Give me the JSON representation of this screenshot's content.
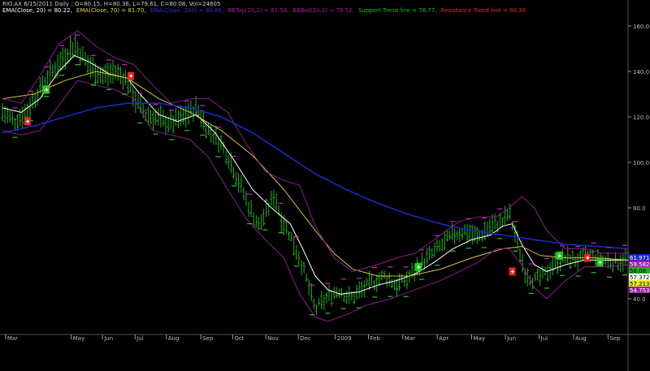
{
  "header": {
    "line1": "RIO.AX 6/15/2011 Daily : O=80.15, H=80.36, L=79.61, C=80.08, Vol=24605",
    "items": [
      {
        "text": "EMA(Close, 20) = 80.22,",
        "color": "#ffffff"
      },
      {
        "text": "EMA(Close, 70) = 81.70,",
        "color": "#e8d44a"
      },
      {
        "text": "EMA(Close, 200) = 80.86,",
        "color": "#2233cc"
      },
      {
        "text": "BBTop(20,2) = 81.58,",
        "color": "#a020a0"
      },
      {
        "text": "BBBot(20,2) = 78.52,",
        "color": "#a020a0"
      },
      {
        "text": "Support Trend line = 78.77,",
        "color": "#22bb22"
      },
      {
        "text": "Resistance Trend line = 80.39",
        "color": "#ee2222"
      }
    ]
  },
  "colors": {
    "background": "#000000",
    "bars": "#1fae1f",
    "ema20": "#ffffff",
    "ema70": "#d4c23a",
    "ema200": "#1a2abf",
    "bollinger": "#8c1c8c",
    "grid": "#333333"
  },
  "chart_data": {
    "type": "line",
    "ylim": [
      25,
      165
    ],
    "y_ticks": [
      {
        "value": 160,
        "label": "160.0"
      },
      {
        "value": 140,
        "label": "140.0"
      },
      {
        "value": 120,
        "label": "120.0"
      },
      {
        "value": 100,
        "label": "100.0"
      },
      {
        "value": 80,
        "label": "80.0"
      },
      {
        "value": 40,
        "label": "40.0"
      }
    ],
    "x_ticks": [
      {
        "t": 0.005,
        "label": "Mar"
      },
      {
        "t": 0.11,
        "label": "May"
      },
      {
        "t": 0.16,
        "label": "Jun"
      },
      {
        "t": 0.212,
        "label": "Jul"
      },
      {
        "t": 0.262,
        "label": "Aug"
      },
      {
        "t": 0.317,
        "label": "Sep"
      },
      {
        "t": 0.368,
        "label": "Oct"
      },
      {
        "t": 0.421,
        "label": "Nov"
      },
      {
        "t": 0.473,
        "label": "Dec"
      },
      {
        "t": 0.532,
        "label": "2009"
      },
      {
        "t": 0.585,
        "label": "Feb"
      },
      {
        "t": 0.64,
        "label": "Mar"
      },
      {
        "t": 0.695,
        "label": "Apr"
      },
      {
        "t": 0.75,
        "label": "May"
      },
      {
        "t": 0.804,
        "label": "Jun"
      },
      {
        "t": 0.858,
        "label": "Jul"
      },
      {
        "t": 0.913,
        "label": "Aug"
      },
      {
        "t": 0.968,
        "label": "Sep"
      }
    ],
    "price_path": [
      [
        0.0,
        122
      ],
      [
        0.02,
        118
      ],
      [
        0.04,
        123
      ],
      [
        0.055,
        130
      ],
      [
        0.07,
        136
      ],
      [
        0.085,
        142
      ],
      [
        0.1,
        147
      ],
      [
        0.115,
        152
      ],
      [
        0.125,
        148
      ],
      [
        0.14,
        142
      ],
      [
        0.16,
        138
      ],
      [
        0.18,
        140
      ],
      [
        0.2,
        136
      ],
      [
        0.215,
        126
      ],
      [
        0.23,
        121
      ],
      [
        0.25,
        119
      ],
      [
        0.27,
        117
      ],
      [
        0.29,
        120
      ],
      [
        0.31,
        124
      ],
      [
        0.33,
        114
      ],
      [
        0.35,
        108
      ],
      [
        0.365,
        100
      ],
      [
        0.38,
        90
      ],
      [
        0.395,
        80
      ],
      [
        0.41,
        72
      ],
      [
        0.425,
        80
      ],
      [
        0.435,
        86
      ],
      [
        0.445,
        76
      ],
      [
        0.46,
        68
      ],
      [
        0.475,
        58
      ],
      [
        0.49,
        45
      ],
      [
        0.5,
        35
      ],
      [
        0.51,
        38
      ],
      [
        0.525,
        42
      ],
      [
        0.54,
        44
      ],
      [
        0.555,
        40
      ],
      [
        0.57,
        43
      ],
      [
        0.59,
        47
      ],
      [
        0.61,
        50
      ],
      [
        0.63,
        46
      ],
      [
        0.645,
        48
      ],
      [
        0.66,
        53
      ],
      [
        0.68,
        58
      ],
      [
        0.7,
        63
      ],
      [
        0.72,
        68
      ],
      [
        0.74,
        70
      ],
      [
        0.76,
        67
      ],
      [
        0.78,
        72
      ],
      [
        0.8,
        74
      ],
      [
        0.81,
        78
      ],
      [
        0.82,
        68
      ],
      [
        0.835,
        52
      ],
      [
        0.85,
        48
      ],
      [
        0.865,
        50
      ],
      [
        0.88,
        55
      ],
      [
        0.9,
        58
      ],
      [
        0.92,
        57
      ],
      [
        0.94,
        59
      ],
      [
        0.96,
        57
      ],
      [
        0.98,
        56
      ],
      [
        1.0,
        58
      ]
    ],
    "series": [
      {
        "key": "ema20",
        "points": [
          [
            0.0,
            124
          ],
          [
            0.03,
            122
          ],
          [
            0.06,
            128
          ],
          [
            0.09,
            140
          ],
          [
            0.115,
            147
          ],
          [
            0.14,
            144
          ],
          [
            0.17,
            139
          ],
          [
            0.2,
            137
          ],
          [
            0.22,
            130
          ],
          [
            0.25,
            121
          ],
          [
            0.28,
            118
          ],
          [
            0.31,
            121
          ],
          [
            0.34,
            113
          ],
          [
            0.37,
            101
          ],
          [
            0.4,
            88
          ],
          [
            0.43,
            80
          ],
          [
            0.46,
            73
          ],
          [
            0.48,
            62
          ],
          [
            0.5,
            50
          ],
          [
            0.52,
            44
          ],
          [
            0.54,
            42
          ],
          [
            0.57,
            43
          ],
          [
            0.6,
            46
          ],
          [
            0.63,
            48
          ],
          [
            0.66,
            51
          ],
          [
            0.69,
            56
          ],
          [
            0.72,
            62
          ],
          [
            0.75,
            66
          ],
          [
            0.78,
            68
          ],
          [
            0.8,
            72
          ],
          [
            0.815,
            73
          ],
          [
            0.83,
            64
          ],
          [
            0.85,
            55
          ],
          [
            0.87,
            52
          ],
          [
            0.9,
            55
          ],
          [
            0.93,
            57
          ],
          [
            0.96,
            57
          ],
          [
            0.98,
            57
          ],
          [
            1.0,
            57
          ]
        ]
      },
      {
        "key": "ema70",
        "points": [
          [
            0.0,
            128
          ],
          [
            0.05,
            130
          ],
          [
            0.1,
            136
          ],
          [
            0.15,
            140
          ],
          [
            0.2,
            137
          ],
          [
            0.25,
            128
          ],
          [
            0.3,
            122
          ],
          [
            0.35,
            114
          ],
          [
            0.4,
            103
          ],
          [
            0.45,
            88
          ],
          [
            0.5,
            70
          ],
          [
            0.53,
            60
          ],
          [
            0.56,
            53
          ],
          [
            0.6,
            50
          ],
          [
            0.65,
            50
          ],
          [
            0.7,
            53
          ],
          [
            0.75,
            58
          ],
          [
            0.8,
            62
          ],
          [
            0.83,
            63
          ],
          [
            0.86,
            59
          ],
          [
            0.9,
            58
          ],
          [
            0.95,
            58
          ],
          [
            1.0,
            57
          ]
        ]
      },
      {
        "key": "ema200",
        "points": [
          [
            0.0,
            113
          ],
          [
            0.05,
            116
          ],
          [
            0.1,
            120
          ],
          [
            0.15,
            124
          ],
          [
            0.2,
            126
          ],
          [
            0.25,
            126
          ],
          [
            0.3,
            124
          ],
          [
            0.35,
            120
          ],
          [
            0.4,
            113
          ],
          [
            0.45,
            104
          ],
          [
            0.5,
            95
          ],
          [
            0.55,
            88
          ],
          [
            0.6,
            82
          ],
          [
            0.65,
            77
          ],
          [
            0.7,
            73
          ],
          [
            0.75,
            70
          ],
          [
            0.8,
            68
          ],
          [
            0.85,
            66
          ],
          [
            0.9,
            64
          ],
          [
            0.95,
            63
          ],
          [
            1.0,
            62
          ]
        ]
      },
      {
        "key": "bollinger_top",
        "points": [
          [
            0.0,
            128
          ],
          [
            0.03,
            126
          ],
          [
            0.06,
            138
          ],
          [
            0.09,
            152
          ],
          [
            0.12,
            158
          ],
          [
            0.15,
            151
          ],
          [
            0.18,
            146
          ],
          [
            0.21,
            143
          ],
          [
            0.24,
            134
          ],
          [
            0.27,
            126
          ],
          [
            0.3,
            128
          ],
          [
            0.33,
            128
          ],
          [
            0.36,
            122
          ],
          [
            0.39,
            108
          ],
          [
            0.42,
            96
          ],
          [
            0.45,
            92
          ],
          [
            0.475,
            90
          ],
          [
            0.5,
            72
          ],
          [
            0.53,
            58
          ],
          [
            0.56,
            52
          ],
          [
            0.6,
            55
          ],
          [
            0.63,
            58
          ],
          [
            0.66,
            60
          ],
          [
            0.7,
            68
          ],
          [
            0.73,
            74
          ],
          [
            0.76,
            76
          ],
          [
            0.79,
            76
          ],
          [
            0.81,
            80
          ],
          [
            0.83,
            85
          ],
          [
            0.85,
            80
          ],
          [
            0.87,
            70
          ],
          [
            0.9,
            62
          ],
          [
            0.93,
            62
          ],
          [
            0.96,
            60
          ],
          [
            1.0,
            60
          ]
        ]
      },
      {
        "key": "bollinger_bottom",
        "points": [
          [
            0.0,
            114
          ],
          [
            0.03,
            112
          ],
          [
            0.06,
            114
          ],
          [
            0.09,
            125
          ],
          [
            0.12,
            136
          ],
          [
            0.15,
            134
          ],
          [
            0.18,
            132
          ],
          [
            0.21,
            128
          ],
          [
            0.24,
            114
          ],
          [
            0.27,
            112
          ],
          [
            0.3,
            110
          ],
          [
            0.33,
            102
          ],
          [
            0.36,
            88
          ],
          [
            0.39,
            75
          ],
          [
            0.42,
            66
          ],
          [
            0.45,
            58
          ],
          [
            0.475,
            42
          ],
          [
            0.5,
            32
          ],
          [
            0.52,
            30
          ],
          [
            0.55,
            33
          ],
          [
            0.58,
            37
          ],
          [
            0.62,
            40
          ],
          [
            0.66,
            44
          ],
          [
            0.7,
            48
          ],
          [
            0.73,
            52
          ],
          [
            0.76,
            56
          ],
          [
            0.79,
            62
          ],
          [
            0.81,
            62
          ],
          [
            0.83,
            55
          ],
          [
            0.85,
            45
          ],
          [
            0.87,
            40
          ],
          [
            0.9,
            48
          ],
          [
            0.93,
            54
          ],
          [
            0.96,
            54
          ],
          [
            1.0,
            55
          ]
        ]
      }
    ],
    "signals": [
      {
        "t": 0.04,
        "price": 118,
        "type": "sell"
      },
      {
        "t": 0.07,
        "price": 132,
        "type": "buy"
      },
      {
        "t": 0.205,
        "price": 138,
        "type": "sell"
      },
      {
        "t": 0.665,
        "price": 54,
        "type": "buy"
      },
      {
        "t": 0.815,
        "price": 52,
        "type": "sell"
      },
      {
        "t": 0.89,
        "price": 59,
        "type": "buy"
      },
      {
        "t": 0.935,
        "price": 58,
        "type": "sell"
      },
      {
        "t": 0.955,
        "price": 56,
        "type": "buy"
      }
    ],
    "right_labels": [
      {
        "text": "61.9714",
        "value": 61.97,
        "bg": "#1a22d8",
        "fg": "#ffffff"
      },
      {
        "text": "59.5827",
        "value": 59.58,
        "bg": "#9c1c9c",
        "fg": "#ffffff"
      },
      {
        "text": "58.08",
        "value": 58.08,
        "bg": "#1fae1f",
        "fg": "#000000"
      },
      {
        "text": "57.3726",
        "value": 57.37,
        "bg": "#ffffff",
        "fg": "#000000"
      },
      {
        "text": "57.2132",
        "value": 57.21,
        "bg": "#e8e832",
        "fg": "#000000"
      },
      {
        "text": "54.7533",
        "value": 54.75,
        "bg": "#9c1c9c",
        "fg": "#ffffff"
      }
    ]
  }
}
